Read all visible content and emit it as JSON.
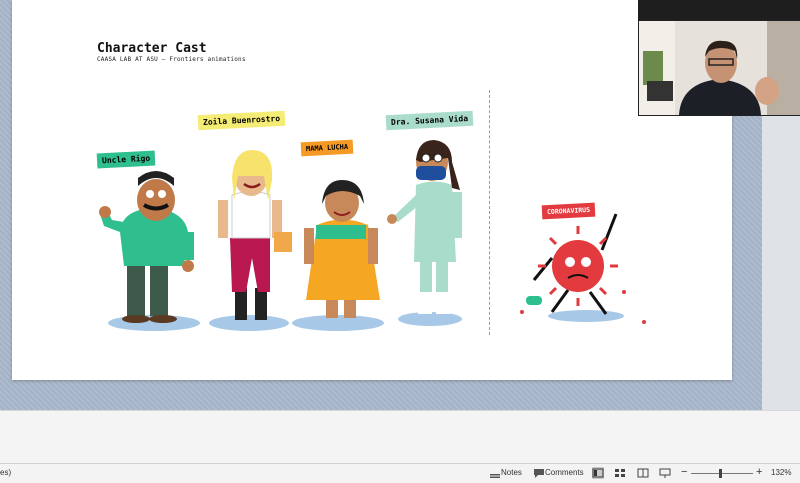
{
  "slide": {
    "title": "Character Cast",
    "subtitle": "CAASA LAB AT ASU – Frontiers animations",
    "tags": [
      {
        "label": "Uncle Rigo",
        "color": "#2fbf8f"
      },
      {
        "label": "Zoila Buenrostro",
        "color": "#f4ec74"
      },
      {
        "label": "MAMA LUCHA",
        "color": "#f59a24"
      },
      {
        "label": "Dra. Susana Vida",
        "color": "#a9dccb"
      },
      {
        "label": "CORONAVIRUS",
        "color": "#e23a3f"
      }
    ]
  },
  "statusbar": {
    "left_fragment": "es)",
    "notes": "Notes",
    "comments": "Comments",
    "zoom": "132%",
    "zoom_out": "−",
    "zoom_in": "+"
  }
}
